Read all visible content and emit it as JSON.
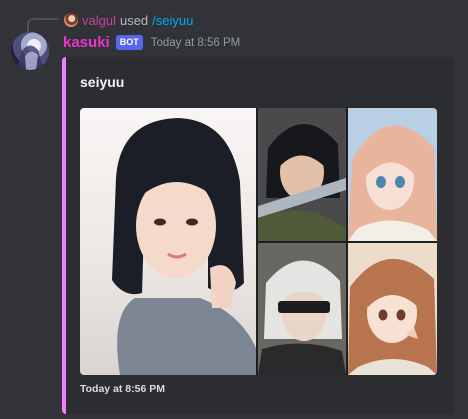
{
  "reply": {
    "username": "valgul",
    "action": "used",
    "command": "/seiyuu"
  },
  "message": {
    "author": "kasuki",
    "badge": "BOT",
    "timestamp": "Today at 8:56 PM"
  },
  "embed": {
    "title": "seiyuu",
    "footer": "Today at 8:56 PM",
    "accent_color": "#f47fff",
    "images": [
      {
        "role": "voice-actress-photo"
      },
      {
        "role": "character-dark-hair-soldier"
      },
      {
        "role": "character-blonde-girl"
      },
      {
        "role": "character-white-hair-blindfold"
      },
      {
        "role": "character-brown-hair-girl"
      }
    ]
  }
}
